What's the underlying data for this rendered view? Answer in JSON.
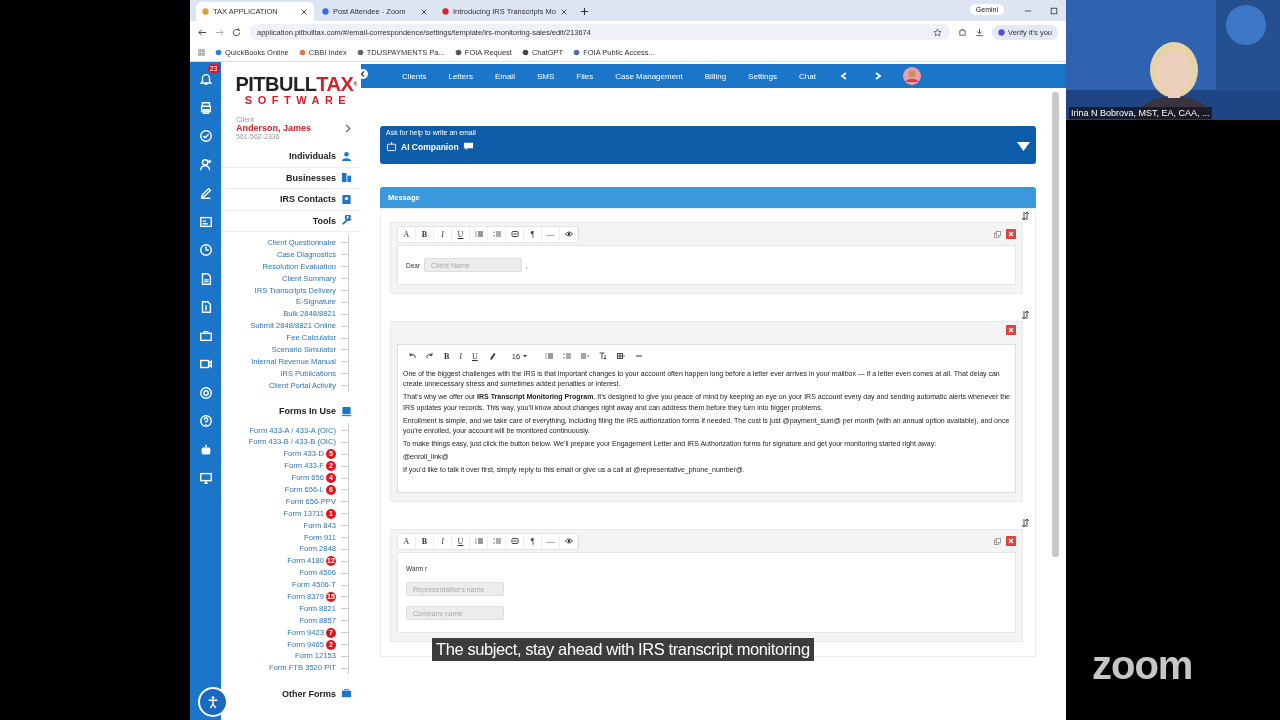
{
  "browser": {
    "tabs": [
      {
        "title": "TAX APPLICATION",
        "selected": true
      },
      {
        "title": "Post Attendee - Zoom",
        "selected": false
      },
      {
        "title": "Introducing IRS Transcripts Mo",
        "selected": false
      }
    ],
    "gemini": "Gemini",
    "url": "application.pitbulltax.com/#/email-correspondence/settings/template/irs-monitoring-sales/edit/213674",
    "verify": "Verify it's you",
    "bookmarks": [
      "QuickBooks Online",
      "CBBI Index",
      "TDUSPAYMENTS Pa...",
      "FOIA Request",
      "ChatGPT",
      "FOIA Public Access..."
    ]
  },
  "app": {
    "notification_count": "23",
    "logo": {
      "part_1": "PITBULL",
      "part_2": "TAX",
      "mark": "®",
      "tagline": "SOFTWARE"
    },
    "client": {
      "label": "Client",
      "name": "Anderson, James",
      "phone": "561-562-2336"
    },
    "sections": [
      {
        "label": "Individuals",
        "kind": "person"
      },
      {
        "label": "Businesses",
        "kind": "building"
      },
      {
        "label": "IRS Contacts",
        "kind": "contacts"
      },
      {
        "label": "Tools",
        "kind": "wrench"
      }
    ],
    "tools": [
      "Client Questionnaire",
      "Case Diagnostics",
      "Resolution Evaluation",
      "Client Summary",
      "IRS Transcripts Delivery",
      "E-Signature",
      "Bulk 2848/8821",
      "Submit 2848/8821 Online",
      "Fee Calculator",
      "Scenario Simulator",
      "Internal Revenue Manual",
      "IRS Publications",
      "Client Portal Activity"
    ],
    "forms_title": "Forms In Use",
    "forms": [
      {
        "label": "Form 433-A / 433-A (OIC)"
      },
      {
        "label": "Form 433-B / 433-B (OIC)"
      },
      {
        "label": "Form 433-D",
        "badge": "5"
      },
      {
        "label": "Form 433-F",
        "badge": "2"
      },
      {
        "label": "Form 656",
        "badge": "4"
      },
      {
        "label": "Form 656-L",
        "badge": "6"
      },
      {
        "label": "Form 656-PPV"
      },
      {
        "label": "Form 13711",
        "badge": "1"
      },
      {
        "label": "Form 843"
      },
      {
        "label": "Form 911"
      },
      {
        "label": "Form 2848"
      },
      {
        "label": "Form 4180",
        "badge": "12"
      },
      {
        "label": "Form 4506"
      },
      {
        "label": "Form 4506-T"
      },
      {
        "label": "Form 8379",
        "badge": "15"
      },
      {
        "label": "Form 8821"
      },
      {
        "label": "Form 8857"
      },
      {
        "label": "Form 9423",
        "badge": "7"
      },
      {
        "label": "Form 9465",
        "badge": "2"
      },
      {
        "label": "Form 12153"
      },
      {
        "label": "Form FTB 3520 PIT"
      }
    ],
    "other_forms": "Other Forms",
    "nav": [
      "Clients",
      "Letters",
      "Email",
      "SMS",
      "Files",
      "Case Management",
      "Billing",
      "Settings",
      "Chat"
    ],
    "ai_companion": {
      "hint": "Ask for help to write an email",
      "title": "AI Companion"
    },
    "message": {
      "title": "Message",
      "blocks": [
        {
          "kind": "simple",
          "toolbar": [
            {
              "kind": "font",
              "label": "A"
            },
            {
              "kind": "bold",
              "label": "B"
            },
            {
              "kind": "italic",
              "label": "I"
            },
            {
              "kind": "underline",
              "label": "U"
            },
            {
              "kind": "bullets"
            },
            {
              "kind": "numbers"
            },
            {
              "kind": "frame"
            },
            {
              "kind": "glyph",
              "label": "¶"
            },
            {
              "kind": "glyph",
              "label": "—"
            },
            {
              "kind": "eye"
            }
          ],
          "lines": [
            {
              "kind": "greeting",
              "text": "Dear",
              "placeholder": "Client Name",
              "after": ","
            }
          ]
        },
        {
          "kind": "rich",
          "toolbar": [
            {
              "kind": "undo"
            },
            {
              "kind": "redo"
            },
            {
              "kind": "bold",
              "label": "B"
            },
            {
              "kind": "italic",
              "label": "I"
            },
            {
              "kind": "underline",
              "label": "U"
            },
            {
              "kind": "eraser"
            },
            {
              "kind": "size",
              "label": "16"
            },
            {
              "kind": "bullets"
            },
            {
              "kind": "numbers"
            },
            {
              "kind": "align"
            },
            {
              "kind": "text_size"
            },
            {
              "kind": "table"
            },
            {
              "kind": "rule"
            }
          ],
          "paragraphs": [
            "One of the biggest challenges with the IRS is that important changes to your account often happen long before a letter ever arrives in your mailbox — if a letter even comes at all. That delay can create unnecessary stress and sometimes added penalties or interest.",
            "That’s why we offer our **IRS Transcript Monitoring Program**. It’s designed to give you peace of mind by keeping an eye on your IRS account every day and sending automatic alerts whenever the IRS updates your records. This way, you’ll know about changes right away and can address them before they turn into bigger problems.",
            "Enrollment is simple, and we take care of everything, including filing the IRS authorization forms if needed. The cost is just @payment_sum@ per month (with an annual option available), and once you’re enrolled, your account will be monitored continuously.",
            "To make things easy, just click the button below. We’ll prepare your Engagement Letter and IRS Authorization forms for signature and get your monitoring started right away:",
            "@enroll_link@",
            "If you’d like to talk it over first, simply reply to this email or give us a call at @representative_phone_number@."
          ]
        },
        {
          "kind": "simple",
          "toolbar": [
            {
              "kind": "font",
              "label": "A"
            },
            {
              "kind": "bold",
              "label": "B"
            },
            {
              "kind": "italic",
              "label": "I"
            },
            {
              "kind": "underline",
              "label": "U"
            },
            {
              "kind": "bullets"
            },
            {
              "kind": "numbers"
            },
            {
              "kind": "frame"
            },
            {
              "kind": "glyph",
              "label": "¶"
            },
            {
              "kind": "glyph",
              "label": "—"
            },
            {
              "kind": "eye"
            }
          ],
          "lines": [
            {
              "kind": "text",
              "text": "Warm r"
            },
            {
              "kind": "field",
              "placeholder": "Representative's name"
            },
            {
              "kind": "field",
              "placeholder": "Company name"
            }
          ]
        }
      ]
    }
  },
  "meeting": {
    "participant": "Irina N Bobrova, MST, EA, CAA, ...",
    "caption": "The subject, stay ahead with IRS transcript monitoring",
    "logo": "zoom"
  }
}
